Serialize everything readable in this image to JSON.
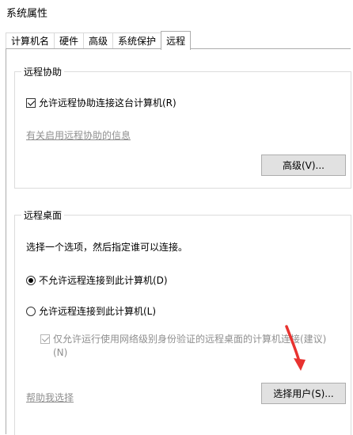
{
  "window": {
    "title": "系统属性"
  },
  "tabs": [
    {
      "label": "计算机名"
    },
    {
      "label": "硬件"
    },
    {
      "label": "高级"
    },
    {
      "label": "系统保护"
    },
    {
      "label": "远程"
    }
  ],
  "remote_assistance": {
    "group_label": "远程协助",
    "allow_label": "允许远程协助连接这台计算机(R)",
    "allow_checked": true,
    "info_link": "有关启用远程协助的信息",
    "advanced_button": "高级(V)..."
  },
  "remote_desktop": {
    "group_label": "远程桌面",
    "instruction": "选择一个选项，然后指定谁可以连接。",
    "option_deny": "不允许远程连接到此计算机(D)",
    "option_allow": "允许远程连接到此计算机(L)",
    "selected_option": "deny",
    "nla_label_line1": "仅允许运行使用网络级别身份验证的远程桌面的计算机连接(建议)",
    "nla_label_line2": "(N)",
    "nla_checked": true,
    "help_link": "帮助我选择",
    "select_users_button": "选择用户(S)..."
  },
  "colors": {
    "arrow": "#e8322f"
  }
}
